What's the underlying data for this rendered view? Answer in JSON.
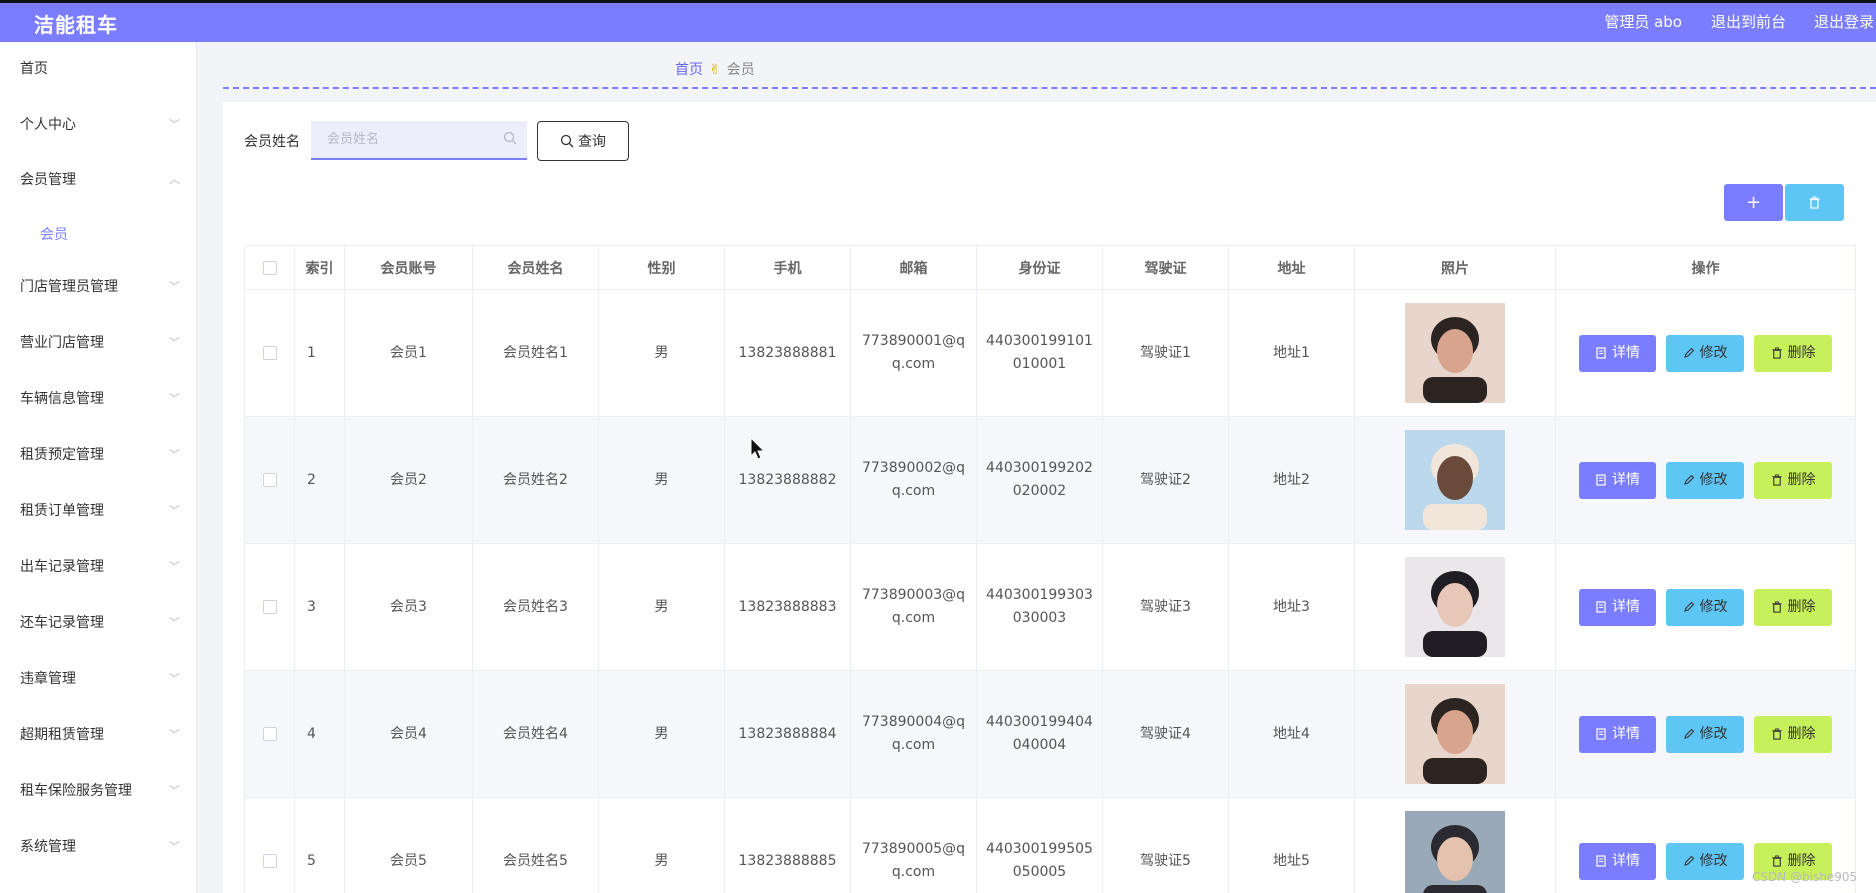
{
  "header": {
    "brand": "洁能租车",
    "user": "管理员 abo",
    "front": "退出到前台",
    "logout": "退出登录"
  },
  "sidebar": {
    "items": [
      {
        "label": "首页",
        "expandable": false
      },
      {
        "label": "个人中心",
        "expandable": true
      },
      {
        "label": "会员管理",
        "expandable": true,
        "expanded": true
      },
      {
        "label": "会员",
        "sub": true
      },
      {
        "label": "门店管理员管理",
        "expandable": true
      },
      {
        "label": "营业门店管理",
        "expandable": true
      },
      {
        "label": "车辆信息管理",
        "expandable": true
      },
      {
        "label": "租赁预定管理",
        "expandable": true
      },
      {
        "label": "租赁订单管理",
        "expandable": true
      },
      {
        "label": "出车记录管理",
        "expandable": true
      },
      {
        "label": "还车记录管理",
        "expandable": true
      },
      {
        "label": "违章管理",
        "expandable": true
      },
      {
        "label": "超期租赁管理",
        "expandable": true
      },
      {
        "label": "租车保险服务管理",
        "expandable": true
      },
      {
        "label": "系统管理",
        "expandable": true
      }
    ]
  },
  "breadcrumb": {
    "home": "首页",
    "current": "会员"
  },
  "search": {
    "label": "会员姓名",
    "placeholder": "会员姓名",
    "value": "",
    "button": "查询"
  },
  "table": {
    "headers": [
      "索引",
      "会员账号",
      "会员姓名",
      "性别",
      "手机",
      "邮箱",
      "身份证",
      "驾驶证",
      "地址",
      "照片",
      "操作"
    ],
    "actions": {
      "detail": "详情",
      "edit": "修改",
      "delete": "删除"
    },
    "rows": [
      {
        "index": "1",
        "account": "会员1",
        "name": "会员姓名1",
        "gender": "男",
        "phone": "13823888881",
        "email_line1": "773890001@q",
        "email_line2": "q.com",
        "id_line1": "440300199101",
        "id_line2": "010001",
        "license": "驾驶证1",
        "address": "地址1"
      },
      {
        "index": "2",
        "account": "会员2",
        "name": "会员姓名2",
        "gender": "男",
        "phone": "13823888882",
        "email_line1": "773890002@q",
        "email_line2": "q.com",
        "id_line1": "440300199202",
        "id_line2": "020002",
        "license": "驾驶证2",
        "address": "地址2"
      },
      {
        "index": "3",
        "account": "会员3",
        "name": "会员姓名3",
        "gender": "男",
        "phone": "13823888883",
        "email_line1": "773890003@q",
        "email_line2": "q.com",
        "id_line1": "440300199303",
        "id_line2": "030003",
        "license": "驾驶证3",
        "address": "地址3"
      },
      {
        "index": "4",
        "account": "会员4",
        "name": "会员姓名4",
        "gender": "男",
        "phone": "13823888884",
        "email_line1": "773890004@q",
        "email_line2": "q.com",
        "id_line1": "440300199404",
        "id_line2": "040004",
        "license": "驾驶证4",
        "address": "地址4"
      },
      {
        "index": "5",
        "account": "会员5",
        "name": "会员姓名5",
        "gender": "男",
        "phone": "13823888885",
        "email_line1": "773890005@q",
        "email_line2": "q.com",
        "id_line1": "440300199505",
        "id_line2": "050005",
        "license": "驾驶证5",
        "address": "地址5"
      }
    ]
  },
  "watermark": "CSDN @bishe905",
  "colors": {
    "accent": "#7a7dff",
    "edit": "#5ec6f5",
    "delete": "#c7f05b"
  }
}
